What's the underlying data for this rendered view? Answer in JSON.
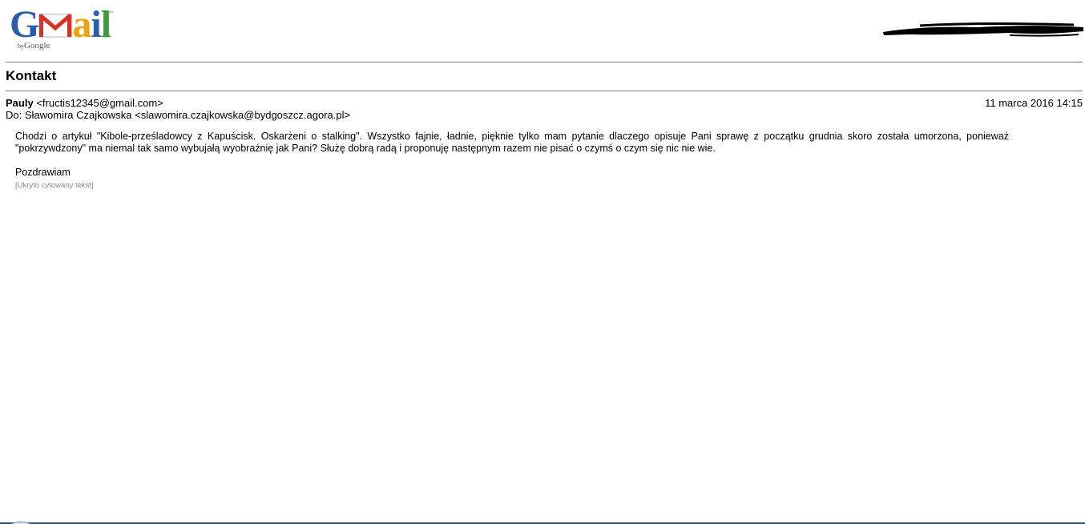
{
  "logo": {
    "brand_g": "G",
    "brand_a": "a",
    "brand_i": "i",
    "brand_l": "l",
    "by_text": "by",
    "google_text": "Google",
    "tm": "™",
    "icon": "gmail-envelope-icon",
    "colors": {
      "blue": "#2a5db0",
      "red": "#d93025",
      "yellow": "#f0a10b",
      "green": "#3a9d3a"
    }
  },
  "thread": {
    "subject": "Kontakt"
  },
  "message": {
    "sender_name": "Pauly",
    "sender_email": "<fructis12345@gmail.com>",
    "date": "11 marca 2016 14:15",
    "to_line": "Do: Sławomira Czajkowska <slawomira.czajkowska@bydgoszcz.agora.pl>",
    "body": "Chodzi o artykuł \"Kibole-prześladowcy z Kapuścisk. Oskarżeni o stalking\". Wszystko fajnie, ładnie, pięknie tylko mam pytanie dlaczego opisuje Pani sprawę z początku grudnia skoro została umorzona, ponieważ \"pokrzywdzony\" ma niemal tak samo wybujałą wyobraźnię jak Pani? Służę dobrą radą i proponuję następnym razem nie pisać o czymś o czym się nic nie wie.",
    "signoff": "Pozdrawiam",
    "hidden_quote": "[Ukryto cytowany tekst]"
  }
}
